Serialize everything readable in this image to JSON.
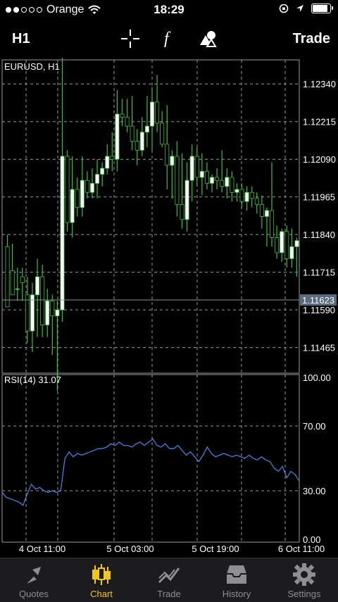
{
  "status": {
    "carrier": "Orange",
    "time": "18:29",
    "signal_dots": 5,
    "signal_filled": 2,
    "battery_level": 0.95
  },
  "toolbar": {
    "timeframe": "H1",
    "crosshair_icon": "crosshair-icon",
    "indicator_icon": "function-icon",
    "objects_icon": "shapes-icon",
    "trade_label": "Trade"
  },
  "chart": {
    "symbol_label": "EURUSD, H1",
    "price_ticks": [
      "1.12340",
      "1.12215",
      "1.12090",
      "1.11965",
      "1.11840",
      "1.11715",
      "1.11590",
      "1.11465"
    ],
    "current_price": "1.11623",
    "rsi_label": "RSI(14) 31.07",
    "rsi_ticks": [
      "100.00",
      "70.00",
      "30.00",
      "0.00"
    ],
    "time_labels": [
      "4 Oct 11:00",
      "5 Oct 03:00",
      "5 Oct 19:00",
      "6 Oct 11:00"
    ],
    "colors": {
      "bull_body": "#ffffff",
      "bear_body": "#000000",
      "wick": "#3fbf3f",
      "rsi_line": "#4a7fd9",
      "grid": "#9a9a9a",
      "price_badge": "#5a6a80"
    }
  },
  "chart_data": [
    {
      "type": "candlestick",
      "title": "EURUSD, H1",
      "ylim": [
        1.1138,
        1.1242
      ],
      "candles": [
        [
          1.118,
          1.1184,
          1.116,
          1.116
        ],
        [
          1.1172,
          1.1181,
          1.1164,
          1.1164
        ],
        [
          1.1166,
          1.1173,
          1.1162,
          1.1166
        ],
        [
          1.117,
          1.1173,
          1.1162,
          1.1168
        ],
        [
          1.1164,
          1.117,
          1.1148,
          1.1152
        ],
        [
          1.1152,
          1.1168,
          1.1145,
          1.1164
        ],
        [
          1.1164,
          1.1176,
          1.115,
          1.117
        ],
        [
          1.117,
          1.1174,
          1.115,
          1.1154
        ],
        [
          1.1154,
          1.1166,
          1.115,
          1.1162
        ],
        [
          1.1162,
          1.1164,
          1.1144,
          1.1157
        ],
        [
          1.1157,
          1.1162,
          1.1132,
          1.1159
        ],
        [
          1.1159,
          1.1246,
          1.1155,
          1.121
        ],
        [
          1.121,
          1.1212,
          1.1185,
          1.1188
        ],
        [
          1.1188,
          1.121,
          1.1183,
          1.1199
        ],
        [
          1.1199,
          1.1203,
          1.119,
          1.1193
        ],
        [
          1.1193,
          1.121,
          1.119,
          1.1202
        ],
        [
          1.1202,
          1.1205,
          1.1196,
          1.1198
        ],
        [
          1.1198,
          1.1206,
          1.1196,
          1.1201
        ],
        [
          1.1201,
          1.1209,
          1.1196,
          1.1204
        ],
        [
          1.1204,
          1.1208,
          1.12,
          1.1206
        ],
        [
          1.1206,
          1.1214,
          1.1204,
          1.121
        ],
        [
          1.121,
          1.1218,
          1.1205,
          1.1209
        ],
        [
          1.1209,
          1.1232,
          1.1205,
          1.1224
        ],
        [
          1.1224,
          1.1229,
          1.122,
          1.1223
        ],
        [
          1.1223,
          1.1229,
          1.1218,
          1.122
        ],
        [
          1.122,
          1.123,
          1.1212,
          1.1215
        ],
        [
          1.1215,
          1.1219,
          1.1207,
          1.1212
        ],
        [
          1.1212,
          1.1223,
          1.121,
          1.1218
        ],
        [
          1.1218,
          1.123,
          1.1213,
          1.122
        ],
        [
          1.122,
          1.1233,
          1.1212,
          1.1228
        ],
        [
          1.1228,
          1.1237,
          1.1218,
          1.1221
        ],
        [
          1.1221,
          1.1225,
          1.1213,
          1.1214
        ],
        [
          1.1214,
          1.1227,
          1.1199,
          1.1207
        ],
        [
          1.1207,
          1.1212,
          1.1196,
          1.121
        ],
        [
          1.121,
          1.1215,
          1.119,
          1.1194
        ],
        [
          1.1194,
          1.1211,
          1.1186,
          1.1189
        ],
        [
          1.1189,
          1.1208,
          1.1185,
          1.1202
        ],
        [
          1.1202,
          1.1214,
          1.1195,
          1.121
        ],
        [
          1.121,
          1.1213,
          1.12,
          1.1203
        ],
        [
          1.1203,
          1.1211,
          1.1197,
          1.1205
        ],
        [
          1.1205,
          1.1208,
          1.1199,
          1.1201
        ],
        [
          1.1201,
          1.1204,
          1.1198,
          1.1203
        ],
        [
          1.1203,
          1.1206,
          1.1199,
          1.1202
        ],
        [
          1.1202,
          1.1212,
          1.1198,
          1.12
        ],
        [
          1.12,
          1.1206,
          1.1196,
          1.1203
        ],
        [
          1.1203,
          1.1205,
          1.1195,
          1.1198
        ],
        [
          1.1198,
          1.1201,
          1.1195,
          1.1199
        ],
        [
          1.1199,
          1.1201,
          1.1193,
          1.1195
        ],
        [
          1.1195,
          1.12,
          1.1192,
          1.1198
        ],
        [
          1.1198,
          1.12,
          1.1193,
          1.1196
        ],
        [
          1.1196,
          1.1198,
          1.1191,
          1.1194
        ],
        [
          1.1194,
          1.1197,
          1.1186,
          1.119
        ],
        [
          1.119,
          1.1193,
          1.118,
          1.1192
        ],
        [
          1.1192,
          1.1208,
          1.118,
          1.1183
        ],
        [
          1.1183,
          1.1187,
          1.1176,
          1.1178
        ],
        [
          1.1178,
          1.1186,
          1.1175,
          1.1185
        ],
        [
          1.1185,
          1.1187,
          1.1173,
          1.1176
        ],
        [
          1.1176,
          1.1186,
          1.1173,
          1.118
        ],
        [
          1.118,
          1.1183,
          1.117,
          1.1182
        ]
      ]
    },
    {
      "type": "line",
      "title": "RSI(14) 31.07",
      "ylim": [
        0,
        100
      ],
      "series": [
        {
          "values": [
            29,
            26,
            25,
            24,
            23,
            21,
            28,
            34,
            31,
            32,
            30,
            29,
            30,
            29,
            30,
            50,
            54,
            51,
            53,
            52,
            53,
            54,
            55,
            56,
            56,
            57,
            59,
            58,
            60,
            58,
            58,
            57,
            59,
            60,
            58,
            60,
            62,
            58,
            57,
            59,
            56,
            56,
            58,
            55,
            52,
            54,
            51,
            48,
            52,
            57,
            53,
            51,
            52,
            53,
            52,
            51,
            52,
            51,
            50,
            52,
            50,
            49,
            51,
            49,
            48,
            44,
            42,
            45,
            38,
            42,
            40,
            36
          ]
        }
      ],
      "categories": [
        "4 Oct 11:00",
        "5 Oct 03:00",
        "5 Oct 19:00",
        "6 Oct 11:00"
      ]
    }
  ],
  "tabs": [
    {
      "label": "Quotes",
      "icon": "quotes-arrows-icon"
    },
    {
      "label": "Chart",
      "icon": "candlestick-chart-icon"
    },
    {
      "label": "Trade",
      "icon": "trend-line-icon"
    },
    {
      "label": "History",
      "icon": "inbox-tray-icon"
    },
    {
      "label": "Settings",
      "icon": "gear-icon"
    }
  ]
}
